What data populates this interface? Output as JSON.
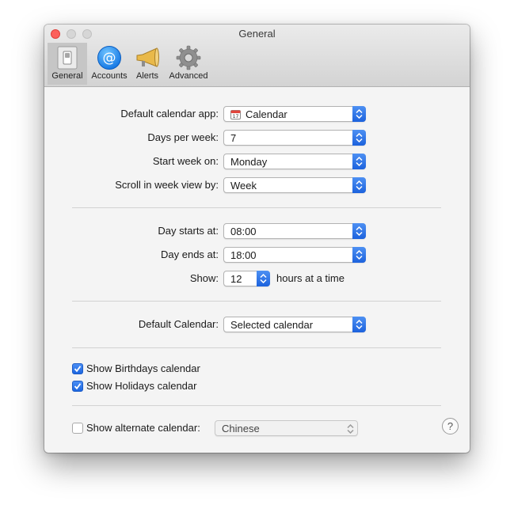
{
  "window": {
    "title": "General",
    "toolbar": [
      {
        "label": "General",
        "icon": "general-switch-icon",
        "selected": true
      },
      {
        "label": "Accounts",
        "icon": "accounts-at-icon",
        "selected": false
      },
      {
        "label": "Alerts",
        "icon": "alerts-megaphone-icon",
        "selected": false
      },
      {
        "label": "Advanced",
        "icon": "advanced-gear-icon",
        "selected": false
      }
    ]
  },
  "settings": {
    "default_app": {
      "label": "Default calendar app:",
      "value": "Calendar"
    },
    "days_per_week": {
      "label": "Days per week:",
      "value": "7"
    },
    "start_week": {
      "label": "Start week on:",
      "value": "Monday"
    },
    "scroll_week": {
      "label": "Scroll in week view by:",
      "value": "Week"
    },
    "day_starts": {
      "label": "Day starts at:",
      "value": "08:00"
    },
    "day_ends": {
      "label": "Day ends at:",
      "value": "18:00"
    },
    "show": {
      "label": "Show:",
      "value": "12",
      "suffix": "hours at a time"
    },
    "default_calendar": {
      "label": "Default Calendar:",
      "value": "Selected calendar"
    },
    "birthdays": {
      "label": "Show Birthdays calendar",
      "checked": true
    },
    "holidays": {
      "label": "Show Holidays calendar",
      "checked": true
    },
    "alternate": {
      "label": "Show alternate calendar:",
      "checked": false,
      "value": "Chinese"
    },
    "help_label": "?"
  },
  "colors": {
    "accent": "#1c62dd",
    "close": "#fc605b"
  }
}
